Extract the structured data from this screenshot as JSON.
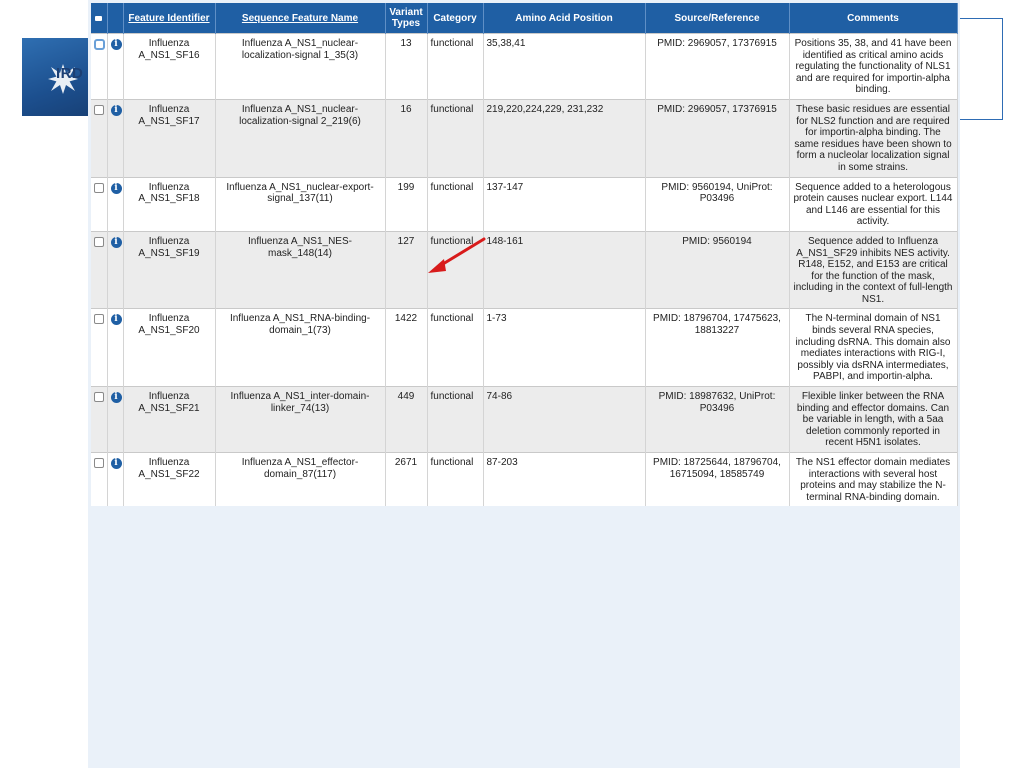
{
  "header": {
    "col_feature_identifier": "Feature Identifier",
    "col_sequence_feature_name": "Sequence Feature Name",
    "col_variant_types": "Variant Types",
    "col_category": "Category",
    "col_amino_acid_position": "Amino Acid Position",
    "col_source_reference": "Source/Reference",
    "col_comments": "Comments"
  },
  "logo_text": "IRD",
  "rows": [
    {
      "id": "Influenza A_NS1_SF16",
      "name": "Influenza A_NS1_nuclear-localization-signal 1_35(3)",
      "variants": "13",
      "category": "functional",
      "position": "35,38,41",
      "source": "PMID: 2969057, 17376915",
      "comments": "Positions 35, 38, and 41 have been identified as critical amino acids regulating the functionality of NLS1 and are required for importin-alpha binding.",
      "selected": true
    },
    {
      "id": "Influenza A_NS1_SF17",
      "name": "Influenza A_NS1_nuclear-localization-signal 2_219(6)",
      "variants": "16",
      "category": "functional",
      "position": "219,220,224,229, 231,232",
      "source": "PMID: 2969057, 17376915",
      "comments": "These basic residues are essential for NLS2 function and are required for importin-alpha binding. The same residues have been shown to form a nucleolar localization signal in some strains.",
      "selected": false
    },
    {
      "id": "Influenza A_NS1_SF18",
      "name": "Influenza A_NS1_nuclear-export-signal_137(11)",
      "variants": "199",
      "category": "functional",
      "position": "137-147",
      "source": "PMID: 9560194, UniProt: P03496",
      "comments": "Sequence added to a heterologous protein causes nuclear export. L144 and L146 are essential for this activity.",
      "selected": false
    },
    {
      "id": "Influenza A_NS1_SF19",
      "name": "Influenza A_NS1_NES-mask_148(14)",
      "variants": "127",
      "category": "functional",
      "position": "148-161",
      "source": "PMID: 9560194",
      "comments": "Sequence added to Influenza A_NS1_SF29 inhibits NES activity. R148, E152, and E153 are critical for the function of the mask, including in the context of full-length NS1.",
      "selected": false
    },
    {
      "id": "Influenza A_NS1_SF20",
      "name": "Influenza A_NS1_RNA-binding-domain_1(73)",
      "variants": "1422",
      "category": "functional",
      "position": "1-73",
      "source": "PMID: 18796704, 17475623, 18813227",
      "comments": "The N-terminal domain of NS1 binds several RNA species, including dsRNA. This domain also mediates interactions with RIG-I, possibly via dsRNA intermediates, PABPI, and importin-alpha.",
      "selected": false
    },
    {
      "id": "Influenza A_NS1_SF21",
      "name": "Influenza A_NS1_inter-domain-linker_74(13)",
      "variants": "449",
      "category": "functional",
      "position": "74-86",
      "source": "PMID: 18987632, UniProt: P03496",
      "comments": "Flexible linker between the RNA binding and effector domains. Can be variable in length, with a 5aa deletion commonly reported in recent H5N1 isolates.",
      "selected": false
    },
    {
      "id": "Influenza A_NS1_SF22",
      "name": "Influenza A_NS1_effector-domain_87(117)",
      "variants": "2671",
      "category": "functional",
      "position": "87-203",
      "source": "PMID: 18725644, 18796704, 16715094, 18585749",
      "comments": "The NS1 effector domain mediates interactions with several host proteins and may stabilize the N-terminal RNA-binding domain.",
      "selected": false
    }
  ],
  "colors": {
    "header_bg": "#1f5fa4",
    "info_icon": "#1f5fa4",
    "arrow": "#d81b1b",
    "row_alt_bg": "#ececec"
  },
  "icons": {
    "info": "info-icon",
    "annotation": "red-arrow-icon"
  }
}
